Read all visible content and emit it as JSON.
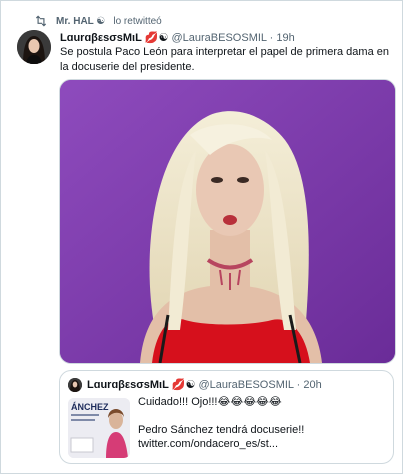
{
  "retweet": {
    "user": "Mr. HAL",
    "user_emojis": "☯",
    "suffix": "lo retwitteó",
    "icon": "retweet-icon"
  },
  "tweet": {
    "author_name": "LɑurɑβεsσsMιL",
    "author_emojis": "💋☯",
    "handle_time": "@LauraBESOSMIL · 19h",
    "text": "Se postula Paco León para interpretar el papel de primera dama en la docuserie del presidente.",
    "media_alt": "photo"
  },
  "quote": {
    "author_name": "LɑurɑβεsσsMιL",
    "author_emojis": "💋☯",
    "handle_time": "@LauraBESOSMIL · 20h",
    "line1": "Cuidado!!! Ojo!!!😂😂😂😂😂",
    "line2": "Pedro Sánchez tendrá docuserie!!",
    "line3": "twitter.com/ondacero_es/st...",
    "thumb_text": "ÁNCHEZ"
  },
  "colors": {
    "text": "#0f1419",
    "secondary": "#536471",
    "border": "#cfd9de",
    "media_bg": "#7c3aa8",
    "dress": "#d6101c"
  }
}
